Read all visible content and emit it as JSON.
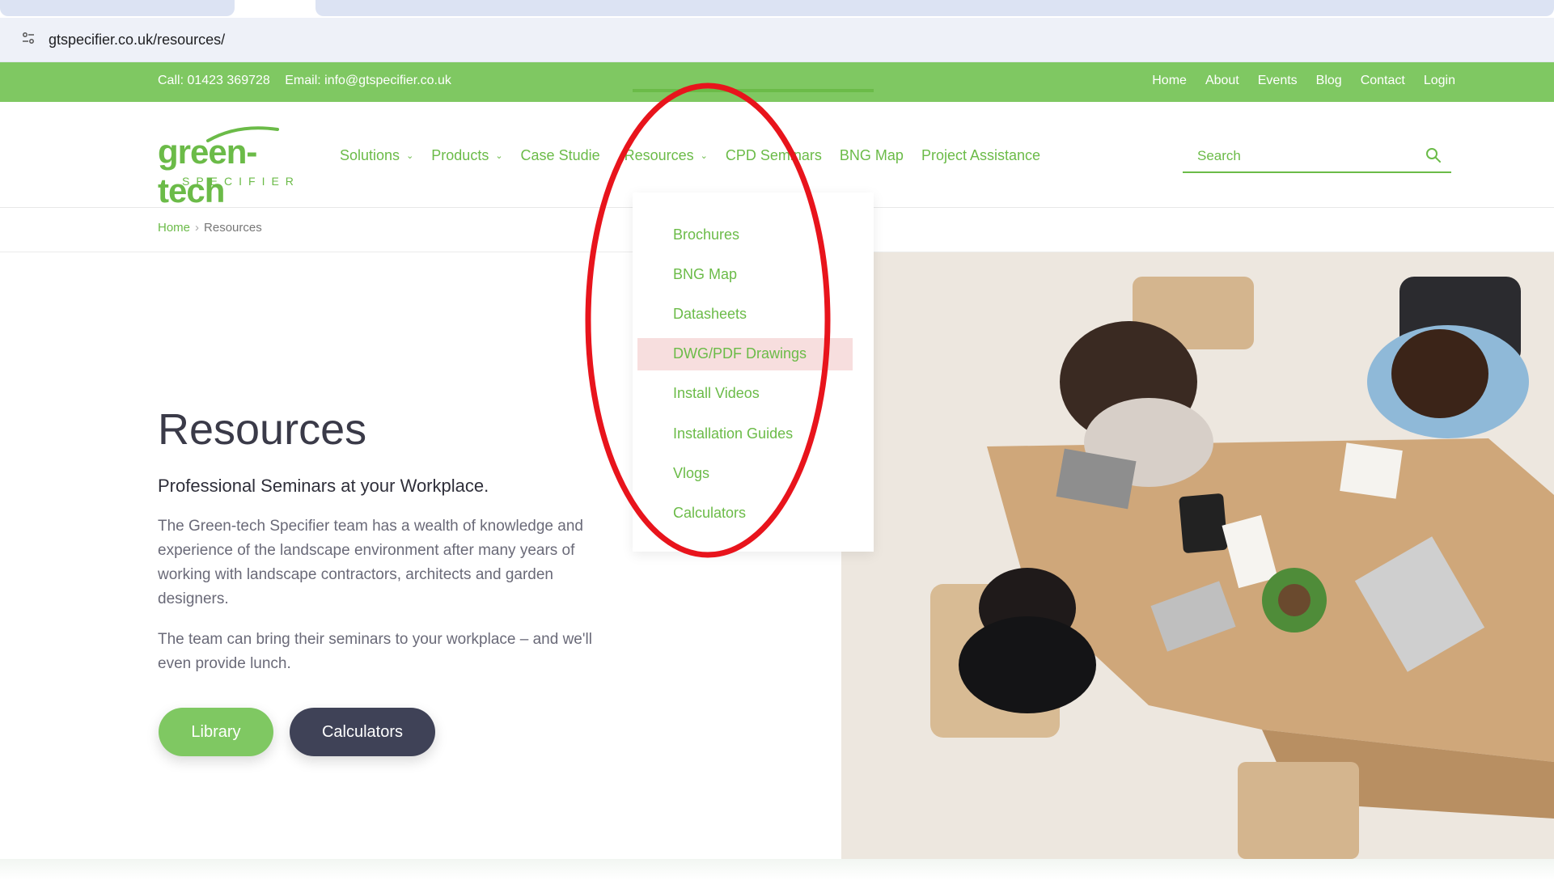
{
  "browser": {
    "url": "gtspecifier.co.uk/resources/"
  },
  "topbar": {
    "call": "Call: 01423 369728",
    "email": "Email: info@gtspecifier.co.uk",
    "nav": [
      "Home",
      "About",
      "Events",
      "Blog",
      "Contact",
      "Login"
    ]
  },
  "logo": {
    "word": "green-tech",
    "sub": "SPECIFIER"
  },
  "mainnav": {
    "solutions": "Solutions",
    "products": "Products",
    "case_studies": "Case Studie",
    "resources": "Resources",
    "cpd_seminars": "CPD Seminars",
    "bng_map": "BNG Map",
    "project_assistance": "Project Assistance"
  },
  "search": {
    "placeholder": "Search"
  },
  "breadcrumb": {
    "home": "Home",
    "separator": "›",
    "current": "Resources"
  },
  "dropdown": {
    "items": [
      "Brochures",
      "BNG Map",
      "Datasheets",
      "DWG/PDF Drawings",
      "Install Videos",
      "Installation Guides",
      "Vlogs",
      "Calculators"
    ]
  },
  "hero": {
    "title": "Resources",
    "subtitle": "Professional Seminars at your Workplace.",
    "p1": "The Green-tech Specifier team has a wealth of knowledge and experience of the landscape environment after many years of working with landscape contractors, architects and garden designers.",
    "p2": "The team can bring their seminars to your workplace – and we'll even provide lunch.",
    "library_label": "Library",
    "calculators_label": "Calculators"
  },
  "colors": {
    "brand_green": "#7fc862",
    "text_green": "#6bbb48",
    "dark_button": "#3f4257",
    "annotation_red": "#e8141c"
  }
}
